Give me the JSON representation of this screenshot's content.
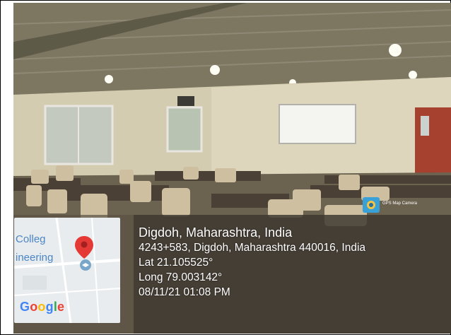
{
  "location": {
    "title": "Digdoh, Maharashtra, India",
    "address": "4243+583, Digdoh, Maharashtra 440016, India",
    "latitude": "Lat 21.105525°",
    "longitude": "Long 79.003142°",
    "datetime": "08/11/21 01:08 PM"
  },
  "map": {
    "label_top": "Colleg",
    "label_bottom": "ineering",
    "brand": "Google",
    "pin_icon": "map-pin-icon",
    "brand_colors": [
      "#4285F4",
      "#EA4335",
      "#FBBC05",
      "#4285F4",
      "#34A853",
      "#EA4335"
    ]
  },
  "badge": {
    "text": "GPS Map Camera",
    "icon": "camera-icon"
  }
}
